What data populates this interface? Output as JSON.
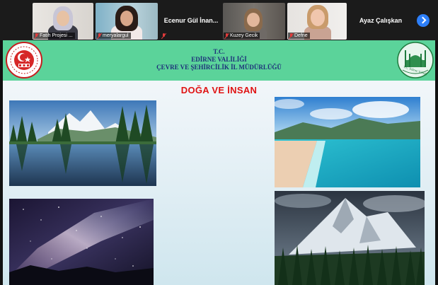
{
  "participants": [
    {
      "name": "Fatih Projesi ...",
      "kind": "video"
    },
    {
      "name": "meryalargul",
      "kind": "video"
    },
    {
      "name": "Ecenur Gül İnan...",
      "kind": "name"
    },
    {
      "name": "Kuzey Gecik",
      "kind": "video"
    },
    {
      "name": "Defne",
      "kind": "video"
    },
    {
      "name": "Ayaz Çalışkan",
      "kind": "name"
    }
  ],
  "slide": {
    "header": {
      "line1": "T.C.",
      "line2": "EDİRNE VALİLİĞİ",
      "line3": "ÇEVRE VE ŞEHİRCİLİK İL MÜDÜRLÜĞÜ"
    },
    "title": "DOĞA VE İNSAN",
    "logo_left_icon": "turkish-emblem-logo",
    "logo_right_icon": "edirne-valiligi-logo",
    "logo_right_text": "T.C. Edirne Valiliği"
  },
  "controls": {
    "next_icon": "chevron-right-icon"
  },
  "colors": {
    "header_green": "#5bd39a",
    "title_red": "#e01313",
    "header_text_blue": "#1d2f7a",
    "next_button_blue": "#2d7ff9",
    "mic_muted_red": "#e23b3b"
  }
}
